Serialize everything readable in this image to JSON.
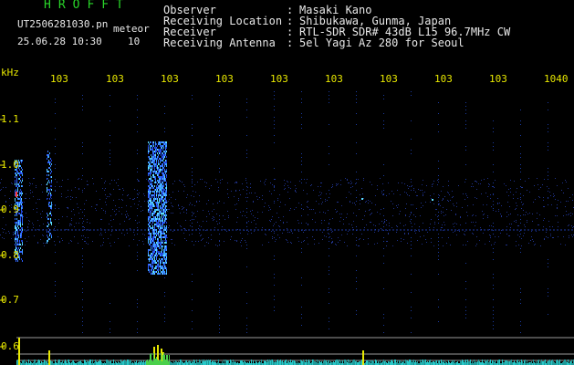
{
  "header": {
    "app_title": "HROFFT",
    "file_name": "UT2506281030.pn",
    "meteor_label": "meteor",
    "date_time": "25.06.28 10:30",
    "count": "10",
    "info": [
      {
        "label": "Observer",
        "value": "Masaki Kano"
      },
      {
        "label": "Receiving Location",
        "value": "Shibukawa, Gunma, Japan"
      },
      {
        "label": "Receiver",
        "value": "RTL-SDR SDR# 43dB L15 96.7MHz CW"
      },
      {
        "label": "Receiving Antenna",
        "value": "5el Yagi Az 280 for Seoul"
      }
    ],
    "colon": ":"
  },
  "axes": {
    "y_unit": "kHz",
    "x_ticks": [
      "103",
      "103",
      "103",
      "103",
      "103",
      "103",
      "103",
      "103",
      "103",
      "1040"
    ],
    "y_ticks": [
      "1.1",
      "1.0",
      "0.9",
      "0.8",
      "0.7",
      "0.6"
    ]
  },
  "colors": {
    "background": "#000000",
    "text_green": "#29d629",
    "text_white": "#e8e8e8",
    "text_yellow": "#e8e800",
    "grid": "#1a3aa0"
  }
}
